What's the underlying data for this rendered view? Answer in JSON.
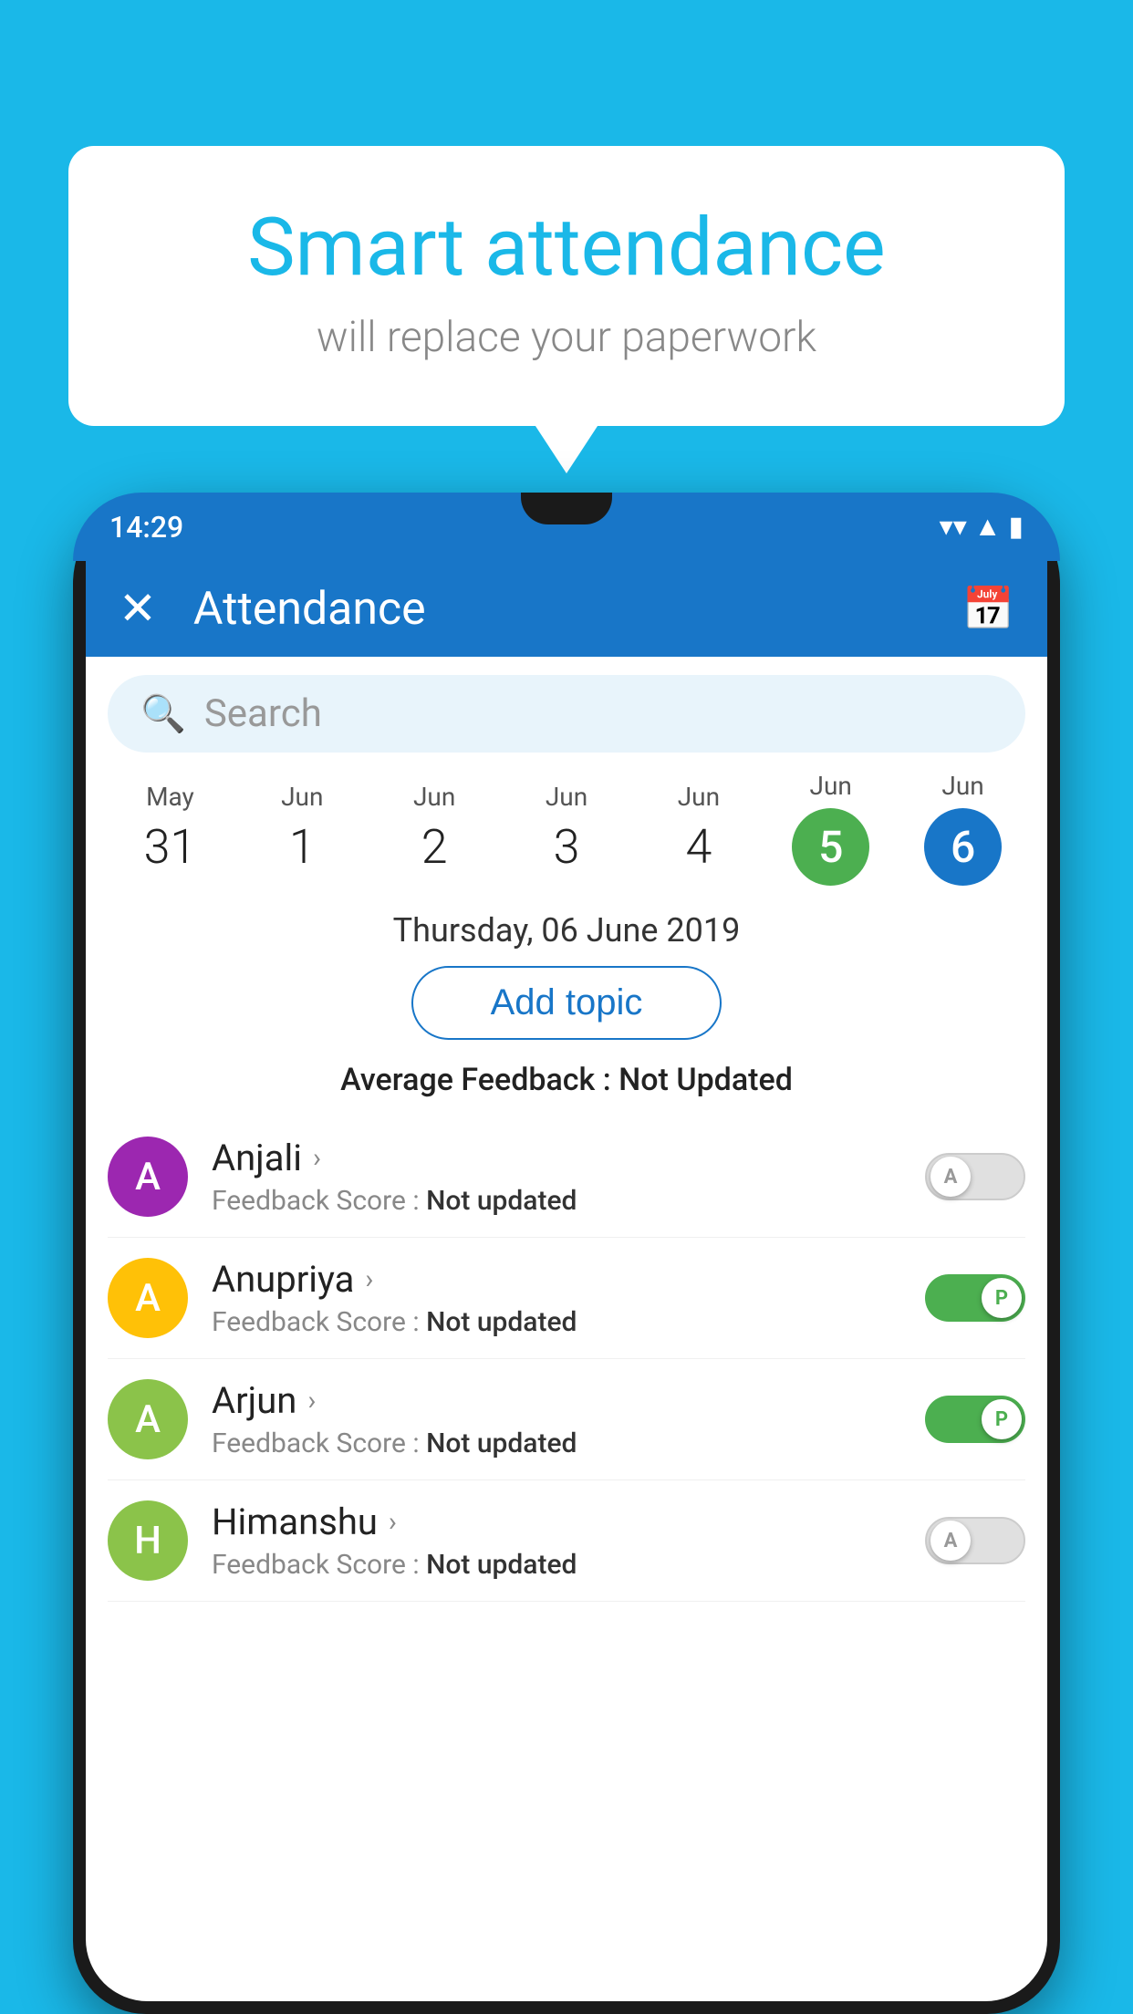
{
  "app": {
    "background_color": "#1ab8e8"
  },
  "speech_bubble": {
    "headline": "Smart attendance",
    "subtext": "will replace your paperwork"
  },
  "phone": {
    "status_bar": {
      "time": "14:29",
      "wifi": "▼",
      "signal": "▲",
      "battery": "▮"
    },
    "header": {
      "title": "Attendance",
      "close_label": "✕",
      "calendar_icon": "📅"
    },
    "search": {
      "placeholder": "Search"
    },
    "calendar": {
      "days": [
        {
          "month": "May",
          "date": "31",
          "state": "normal"
        },
        {
          "month": "Jun",
          "date": "1",
          "state": "normal"
        },
        {
          "month": "Jun",
          "date": "2",
          "state": "normal"
        },
        {
          "month": "Jun",
          "date": "3",
          "state": "normal"
        },
        {
          "month": "Jun",
          "date": "4",
          "state": "normal"
        },
        {
          "month": "Jun",
          "date": "5",
          "state": "today"
        },
        {
          "month": "Jun",
          "date": "6",
          "state": "selected"
        }
      ]
    },
    "selected_date_label": "Thursday, 06 June 2019",
    "add_topic_label": "Add topic",
    "avg_feedback_prefix": "Average Feedback : ",
    "avg_feedback_value": "Not Updated",
    "students": [
      {
        "name": "Anjali",
        "avatar_letter": "A",
        "avatar_color": "#9c27b0",
        "feedback_prefix": "Feedback Score : ",
        "feedback_value": "Not updated",
        "toggle": "off",
        "toggle_label": "A"
      },
      {
        "name": "Anupriya",
        "avatar_letter": "A",
        "avatar_color": "#ffc107",
        "feedback_prefix": "Feedback Score : ",
        "feedback_value": "Not updated",
        "toggle": "on",
        "toggle_label": "P"
      },
      {
        "name": "Arjun",
        "avatar_letter": "A",
        "avatar_color": "#8bc34a",
        "feedback_prefix": "Feedback Score : ",
        "feedback_value": "Not updated",
        "toggle": "on",
        "toggle_label": "P"
      },
      {
        "name": "Himanshu",
        "avatar_letter": "H",
        "avatar_color": "#8bc34a",
        "feedback_prefix": "Feedback Score : ",
        "feedback_value": "Not updated",
        "toggle": "off",
        "toggle_label": "A"
      }
    ]
  }
}
